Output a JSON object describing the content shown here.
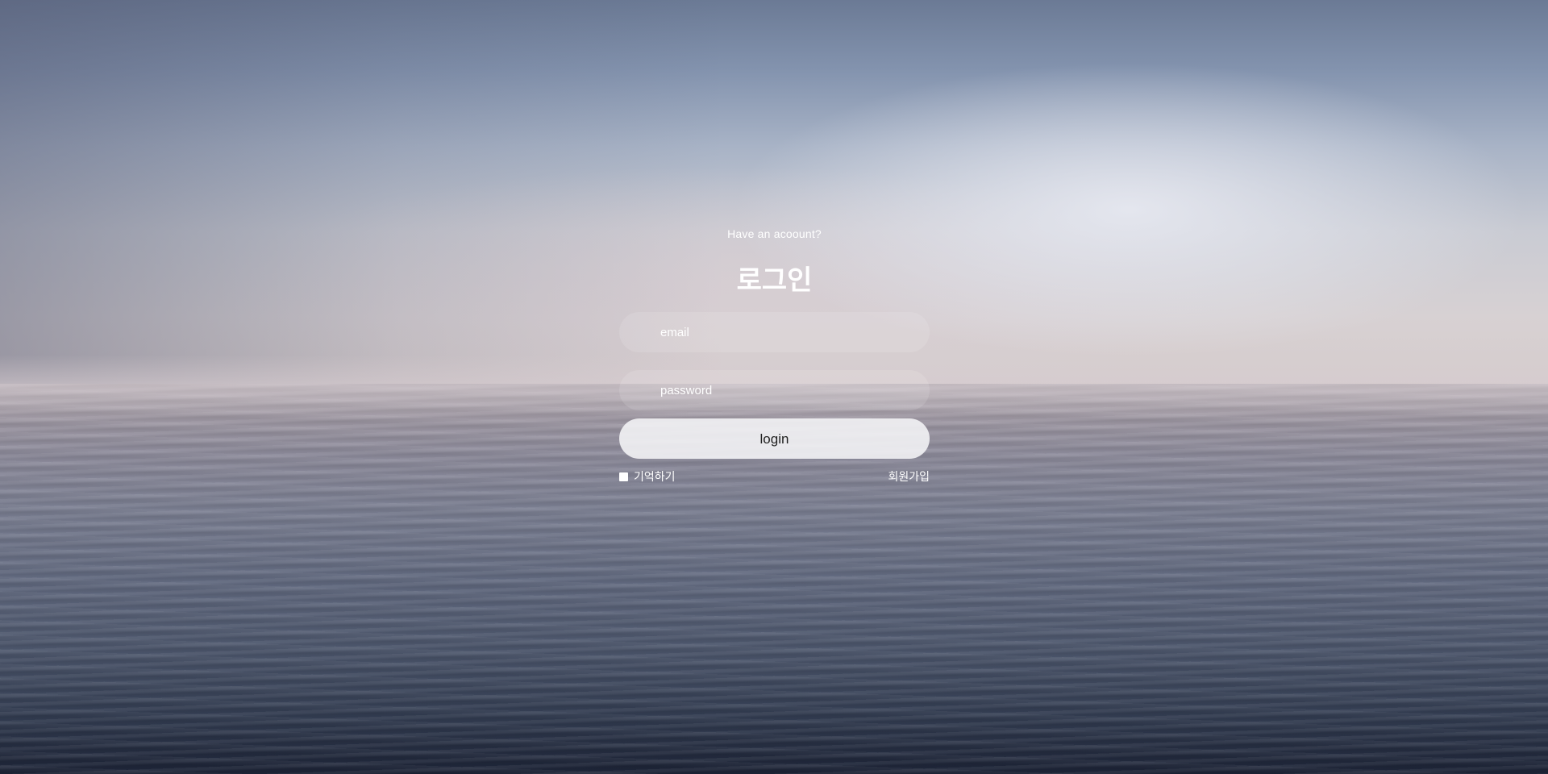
{
  "login": {
    "subtitle": "Have an acoount?",
    "title": "로그인",
    "email_placeholder": "email",
    "password_placeholder": "password",
    "login_label": "login",
    "remember_label": "기억하기",
    "remember_checked": false,
    "signup_label": "회원가입"
  }
}
